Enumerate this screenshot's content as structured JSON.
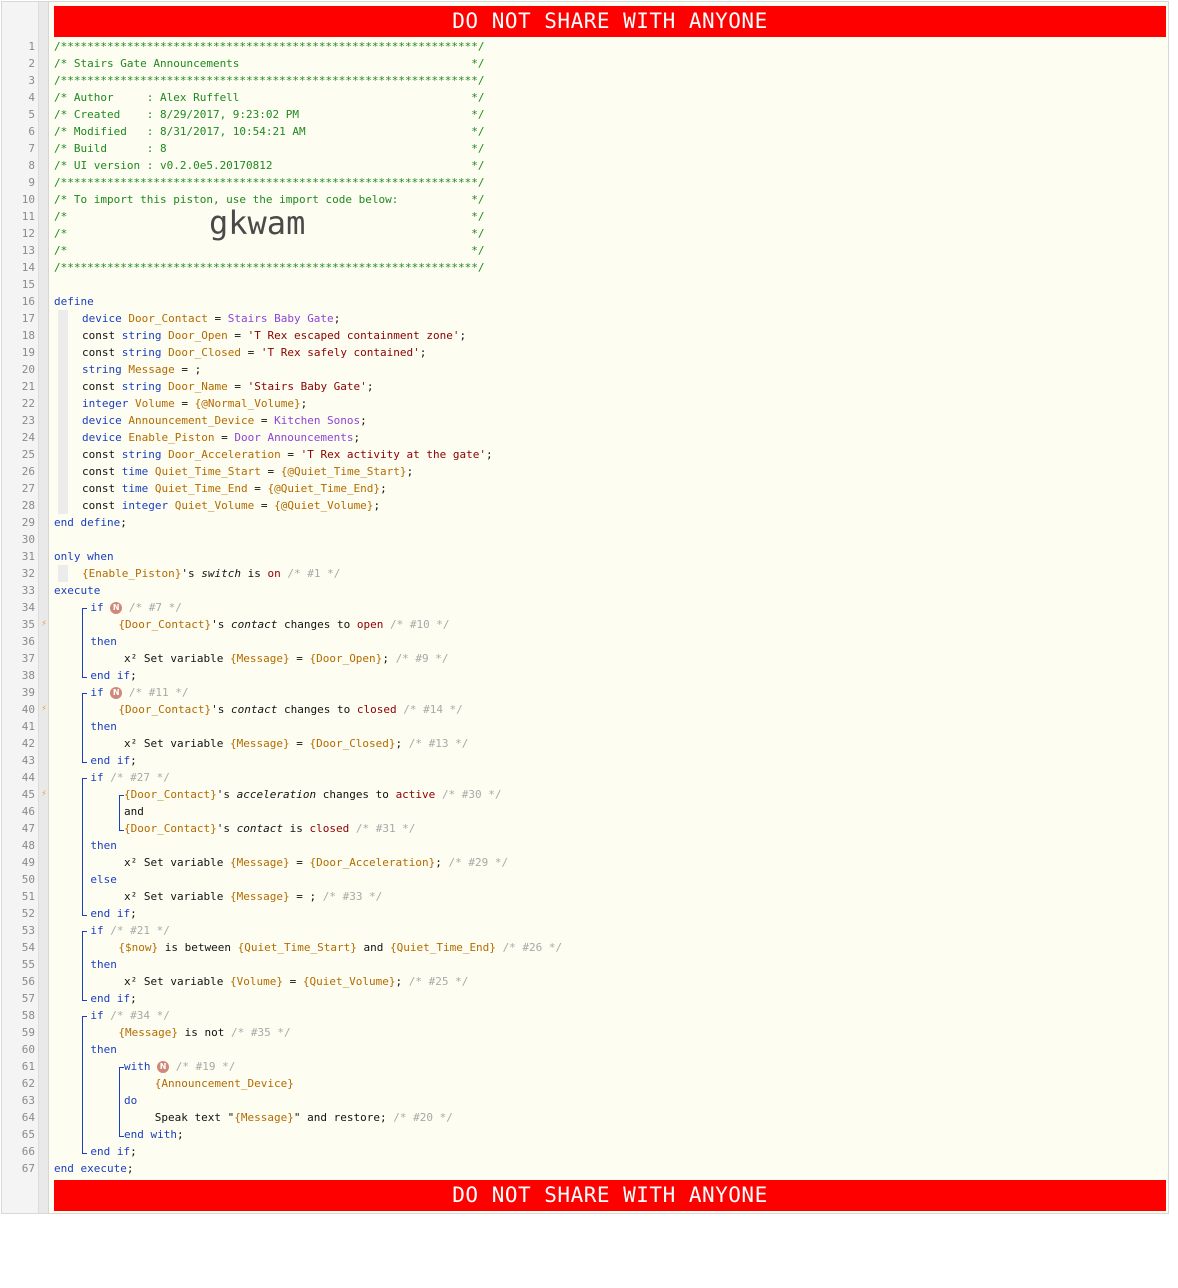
{
  "banner": {
    "text": "DO NOT SHARE WITH ANYONE"
  },
  "import_code": "gkwam",
  "trigger_lines": [
    35,
    40,
    45
  ],
  "lines": [
    {
      "n": 1,
      "indent": 0,
      "segs": [
        [
          "c",
          "/***************************************************************/"
        ]
      ]
    },
    {
      "n": 2,
      "indent": 0,
      "segs": [
        [
          "c",
          "/* Stairs Gate Announcements                                   */"
        ]
      ]
    },
    {
      "n": 3,
      "indent": 0,
      "segs": [
        [
          "c",
          "/***************************************************************/"
        ]
      ]
    },
    {
      "n": 4,
      "indent": 0,
      "segs": [
        [
          "c",
          "/* Author     : Alex Ruffell                                   */"
        ]
      ]
    },
    {
      "n": 5,
      "indent": 0,
      "segs": [
        [
          "c",
          "/* Created    : 8/29/2017, 9:23:02 PM                          */"
        ]
      ]
    },
    {
      "n": 6,
      "indent": 0,
      "segs": [
        [
          "c",
          "/* Modified   : 8/31/2017, 10:54:21 AM                         */"
        ]
      ]
    },
    {
      "n": 7,
      "indent": 0,
      "segs": [
        [
          "c",
          "/* Build      : 8                                              */"
        ]
      ]
    },
    {
      "n": 8,
      "indent": 0,
      "segs": [
        [
          "c",
          "/* UI version : v0.2.0e5.20170812                              */"
        ]
      ]
    },
    {
      "n": 9,
      "indent": 0,
      "segs": [
        [
          "c",
          "/***************************************************************/"
        ]
      ]
    },
    {
      "n": 10,
      "indent": 0,
      "segs": [
        [
          "c",
          "/* To import this piston, use the import code below:           */"
        ]
      ]
    },
    {
      "n": 11,
      "indent": 0,
      "segs": [
        [
          "c",
          "/*                                                             */"
        ]
      ]
    },
    {
      "n": 12,
      "indent": 0,
      "segs": [
        [
          "c",
          "/*                                                             */"
        ]
      ],
      "bigcode": true
    },
    {
      "n": 13,
      "indent": 0,
      "segs": [
        [
          "c",
          "/*                                                             */"
        ]
      ]
    },
    {
      "n": 14,
      "indent": 0,
      "segs": [
        [
          "c",
          "/***************************************************************/"
        ]
      ]
    },
    {
      "n": 15,
      "indent": 0,
      "segs": []
    },
    {
      "n": 16,
      "indent": 0,
      "segs": [
        [
          "k",
          "define"
        ]
      ]
    },
    {
      "n": 17,
      "indent": 1,
      "segs": [
        [
          "t",
          "device "
        ],
        [
          "v",
          "Door_Contact"
        ],
        [
          "x",
          " = "
        ],
        [
          "p",
          "Stairs Baby Gate"
        ],
        [
          "x",
          ";"
        ]
      ]
    },
    {
      "n": 18,
      "indent": 1,
      "segs": [
        [
          "x",
          "const "
        ],
        [
          "t",
          "string "
        ],
        [
          "v",
          "Door_Open"
        ],
        [
          "x",
          " = "
        ],
        [
          "s",
          "'T Rex escaped containment zone'"
        ],
        [
          "x",
          ";"
        ]
      ]
    },
    {
      "n": 19,
      "indent": 1,
      "segs": [
        [
          "x",
          "const "
        ],
        [
          "t",
          "string "
        ],
        [
          "v",
          "Door_Closed"
        ],
        [
          "x",
          " = "
        ],
        [
          "s",
          "'T Rex safely contained'"
        ],
        [
          "x",
          ";"
        ]
      ]
    },
    {
      "n": 20,
      "indent": 1,
      "segs": [
        [
          "t",
          "string "
        ],
        [
          "v",
          "Message"
        ],
        [
          "x",
          " = ;"
        ]
      ]
    },
    {
      "n": 21,
      "indent": 1,
      "segs": [
        [
          "x",
          "const "
        ],
        [
          "t",
          "string "
        ],
        [
          "v",
          "Door_Name"
        ],
        [
          "x",
          " = "
        ],
        [
          "s",
          "'Stairs Baby Gate'"
        ],
        [
          "x",
          ";"
        ]
      ]
    },
    {
      "n": 22,
      "indent": 1,
      "segs": [
        [
          "t",
          "integer "
        ],
        [
          "v",
          "Volume"
        ],
        [
          "x",
          " = "
        ],
        [
          "v",
          "{@Normal_Volume}"
        ],
        [
          "x",
          ";"
        ]
      ]
    },
    {
      "n": 23,
      "indent": 1,
      "segs": [
        [
          "t",
          "device "
        ],
        [
          "v",
          "Announcement_Device"
        ],
        [
          "x",
          " = "
        ],
        [
          "p",
          "Kitchen Sonos"
        ],
        [
          "x",
          ";"
        ]
      ]
    },
    {
      "n": 24,
      "indent": 1,
      "segs": [
        [
          "t",
          "device "
        ],
        [
          "v",
          "Enable_Piston"
        ],
        [
          "x",
          " = "
        ],
        [
          "p",
          "Door Announcements"
        ],
        [
          "x",
          ";"
        ]
      ]
    },
    {
      "n": 25,
      "indent": 1,
      "segs": [
        [
          "x",
          "const "
        ],
        [
          "t",
          "string "
        ],
        [
          "v",
          "Door_Acceleration"
        ],
        [
          "x",
          " = "
        ],
        [
          "s",
          "'T Rex activity at the gate'"
        ],
        [
          "x",
          ";"
        ]
      ]
    },
    {
      "n": 26,
      "indent": 1,
      "segs": [
        [
          "x",
          "const "
        ],
        [
          "t",
          "time "
        ],
        [
          "v",
          "Quiet_Time_Start"
        ],
        [
          "x",
          " = "
        ],
        [
          "v",
          "{@Quiet_Time_Start}"
        ],
        [
          "x",
          ";"
        ]
      ]
    },
    {
      "n": 27,
      "indent": 1,
      "segs": [
        [
          "x",
          "const "
        ],
        [
          "t",
          "time "
        ],
        [
          "v",
          "Quiet_Time_End"
        ],
        [
          "x",
          " = "
        ],
        [
          "v",
          "{@Quiet_Time_End}"
        ],
        [
          "x",
          ";"
        ]
      ]
    },
    {
      "n": 28,
      "indent": 1,
      "segs": [
        [
          "x",
          "const "
        ],
        [
          "t",
          "integer "
        ],
        [
          "v",
          "Quiet_Volume"
        ],
        [
          "x",
          " = "
        ],
        [
          "v",
          "{@Quiet_Volume}"
        ],
        [
          "x",
          ";"
        ]
      ]
    },
    {
      "n": 29,
      "indent": 0,
      "segs": [
        [
          "k",
          "end define"
        ],
        [
          "x",
          ";"
        ]
      ]
    },
    {
      "n": 30,
      "indent": 0,
      "segs": []
    },
    {
      "n": 31,
      "indent": 0,
      "segs": [
        [
          "k",
          "only when"
        ]
      ]
    },
    {
      "n": 32,
      "indent": 1,
      "segs": [
        [
          "v",
          "{Enable_Piston}"
        ],
        [
          "x",
          "'s "
        ],
        [
          "xi",
          "switch"
        ],
        [
          "x",
          " is "
        ],
        [
          "s",
          "on"
        ],
        [
          "x",
          " "
        ],
        [
          "cm",
          "/* #1 */"
        ]
      ]
    },
    {
      "n": 33,
      "indent": 0,
      "segs": [
        [
          "k",
          "execute"
        ]
      ]
    },
    {
      "n": 34,
      "indent": 1.3,
      "segs": [
        [
          "k",
          "if "
        ],
        [
          "badge",
          "N"
        ],
        [
          "x",
          " "
        ],
        [
          "cm",
          "/* #7 */"
        ]
      ]
    },
    {
      "n": 35,
      "indent": 2.3,
      "segs": [
        [
          "v",
          "{Door_Contact}"
        ],
        [
          "x",
          "'s "
        ],
        [
          "xi",
          "contact"
        ],
        [
          "x",
          " changes to "
        ],
        [
          "s",
          "open"
        ],
        [
          "x",
          " "
        ],
        [
          "cm",
          "/* #10 */"
        ]
      ]
    },
    {
      "n": 36,
      "indent": 1.3,
      "segs": [
        [
          "k",
          "then"
        ]
      ]
    },
    {
      "n": 37,
      "indent": 2.5,
      "segs": [
        [
          "x",
          "x² Set variable "
        ],
        [
          "v",
          "{Message}"
        ],
        [
          "x",
          " = "
        ],
        [
          "v",
          "{Door_Open}"
        ],
        [
          "x",
          "; "
        ],
        [
          "cm",
          "/* #9 */"
        ]
      ]
    },
    {
      "n": 38,
      "indent": 1.3,
      "segs": [
        [
          "k",
          "end if"
        ],
        [
          "x",
          ";"
        ]
      ]
    },
    {
      "n": 39,
      "indent": 1.3,
      "segs": [
        [
          "k",
          "if "
        ],
        [
          "badge",
          "N"
        ],
        [
          "x",
          " "
        ],
        [
          "cm",
          "/* #11 */"
        ]
      ]
    },
    {
      "n": 40,
      "indent": 2.3,
      "segs": [
        [
          "v",
          "{Door_Contact}"
        ],
        [
          "x",
          "'s "
        ],
        [
          "xi",
          "contact"
        ],
        [
          "x",
          " changes to "
        ],
        [
          "s",
          "closed"
        ],
        [
          "x",
          " "
        ],
        [
          "cm",
          "/* #14 */"
        ]
      ]
    },
    {
      "n": 41,
      "indent": 1.3,
      "segs": [
        [
          "k",
          "then"
        ]
      ]
    },
    {
      "n": 42,
      "indent": 2.5,
      "segs": [
        [
          "x",
          "x² Set variable "
        ],
        [
          "v",
          "{Message}"
        ],
        [
          "x",
          " = "
        ],
        [
          "v",
          "{Door_Closed}"
        ],
        [
          "x",
          "; "
        ],
        [
          "cm",
          "/* #13 */"
        ]
      ]
    },
    {
      "n": 43,
      "indent": 1.3,
      "segs": [
        [
          "k",
          "end if"
        ],
        [
          "x",
          ";"
        ]
      ]
    },
    {
      "n": 44,
      "indent": 1.3,
      "segs": [
        [
          "k",
          "if "
        ],
        [
          "cm",
          "/* #27 */"
        ]
      ]
    },
    {
      "n": 45,
      "indent": 2.5,
      "segs": [
        [
          "v",
          "{Door_Contact}"
        ],
        [
          "x",
          "'s "
        ],
        [
          "xi",
          "acceleration"
        ],
        [
          "x",
          " changes to "
        ],
        [
          "s",
          "active"
        ],
        [
          "x",
          " "
        ],
        [
          "cm",
          "/* #30 */"
        ]
      ]
    },
    {
      "n": 46,
      "indent": 2.5,
      "segs": [
        [
          "x",
          "and"
        ]
      ]
    },
    {
      "n": 47,
      "indent": 2.5,
      "segs": [
        [
          "v",
          "{Door_Contact}"
        ],
        [
          "x",
          "'s "
        ],
        [
          "xi",
          "contact"
        ],
        [
          "x",
          " is "
        ],
        [
          "s",
          "closed"
        ],
        [
          "x",
          " "
        ],
        [
          "cm",
          "/* #31 */"
        ]
      ]
    },
    {
      "n": 48,
      "indent": 1.3,
      "segs": [
        [
          "k",
          "then"
        ]
      ]
    },
    {
      "n": 49,
      "indent": 2.5,
      "segs": [
        [
          "x",
          "x² Set variable "
        ],
        [
          "v",
          "{Message}"
        ],
        [
          "x",
          " = "
        ],
        [
          "v",
          "{Door_Acceleration}"
        ],
        [
          "x",
          "; "
        ],
        [
          "cm",
          "/* #29 */"
        ]
      ]
    },
    {
      "n": 50,
      "indent": 1.3,
      "segs": [
        [
          "k",
          "else"
        ]
      ]
    },
    {
      "n": 51,
      "indent": 2.5,
      "segs": [
        [
          "x",
          "x² Set variable "
        ],
        [
          "v",
          "{Message}"
        ],
        [
          "x",
          " = ; "
        ],
        [
          "cm",
          "/* #33 */"
        ]
      ]
    },
    {
      "n": 52,
      "indent": 1.3,
      "segs": [
        [
          "k",
          "end if"
        ],
        [
          "x",
          ";"
        ]
      ]
    },
    {
      "n": 53,
      "indent": 1.3,
      "segs": [
        [
          "k",
          "if "
        ],
        [
          "cm",
          "/* #21 */"
        ]
      ]
    },
    {
      "n": 54,
      "indent": 2.3,
      "segs": [
        [
          "v",
          "{$now}"
        ],
        [
          "x",
          " is between "
        ],
        [
          "v",
          "{Quiet_Time_Start}"
        ],
        [
          "x",
          " and "
        ],
        [
          "v",
          "{Quiet_Time_End}"
        ],
        [
          "x",
          " "
        ],
        [
          "cm",
          "/* #26 */"
        ]
      ]
    },
    {
      "n": 55,
      "indent": 1.3,
      "segs": [
        [
          "k",
          "then"
        ]
      ]
    },
    {
      "n": 56,
      "indent": 2.5,
      "segs": [
        [
          "x",
          "x² Set variable "
        ],
        [
          "v",
          "{Volume}"
        ],
        [
          "x",
          " = "
        ],
        [
          "v",
          "{Quiet_Volume}"
        ],
        [
          "x",
          "; "
        ],
        [
          "cm",
          "/* #25 */"
        ]
      ]
    },
    {
      "n": 57,
      "indent": 1.3,
      "segs": [
        [
          "k",
          "end if"
        ],
        [
          "x",
          ";"
        ]
      ]
    },
    {
      "n": 58,
      "indent": 1.3,
      "segs": [
        [
          "k",
          "if "
        ],
        [
          "cm",
          "/* #34 */"
        ]
      ]
    },
    {
      "n": 59,
      "indent": 2.3,
      "segs": [
        [
          "v",
          "{Message}"
        ],
        [
          "x",
          " is not "
        ],
        [
          "cm",
          "/* #35 */"
        ]
      ]
    },
    {
      "n": 60,
      "indent": 1.3,
      "segs": [
        [
          "k",
          "then"
        ]
      ]
    },
    {
      "n": 61,
      "indent": 2.5,
      "segs": [
        [
          "k",
          "with "
        ],
        [
          "badge",
          "N"
        ],
        [
          "x",
          " "
        ],
        [
          "cm",
          "/* #19 */"
        ]
      ]
    },
    {
      "n": 62,
      "indent": 3.6,
      "segs": [
        [
          "v",
          "{Announcement_Device}"
        ]
      ]
    },
    {
      "n": 63,
      "indent": 2.5,
      "segs": [
        [
          "k",
          "do"
        ]
      ]
    },
    {
      "n": 64,
      "indent": 3.6,
      "segs": [
        [
          "x",
          "Speak text \""
        ],
        [
          "v",
          "{Message}"
        ],
        [
          "x",
          "\" and restore; "
        ],
        [
          "cm",
          "/* #20 */"
        ]
      ]
    },
    {
      "n": 65,
      "indent": 2.5,
      "segs": [
        [
          "k",
          "end with"
        ],
        [
          "x",
          ";"
        ]
      ]
    },
    {
      "n": 66,
      "indent": 1.3,
      "segs": [
        [
          "k",
          "end if"
        ],
        [
          "x",
          ";"
        ]
      ]
    },
    {
      "n": 67,
      "indent": 0,
      "segs": [
        [
          "k",
          "end execute"
        ],
        [
          "x",
          ";"
        ]
      ]
    }
  ]
}
